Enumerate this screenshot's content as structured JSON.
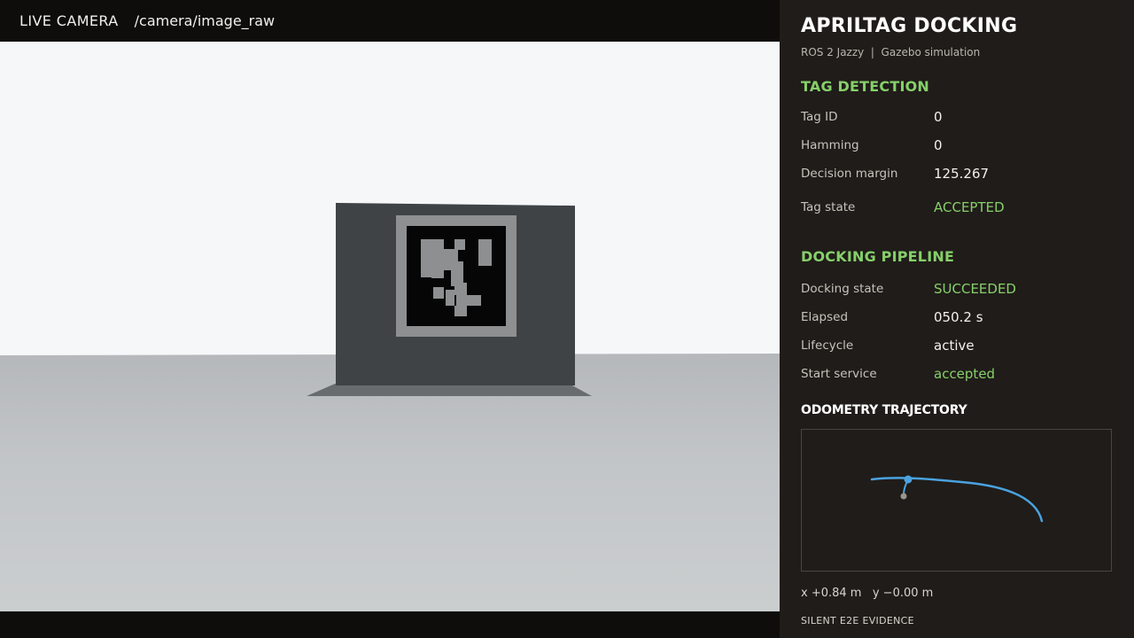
{
  "camera": {
    "title": "LIVE CAMERA",
    "topic": "/camera/image_raw"
  },
  "panel": {
    "title": "APRILTAG DOCKING",
    "subtitle": "ROS 2 Jazzy  |  Gazebo simulation",
    "tag_detection": {
      "heading": "TAG DETECTION",
      "rows": [
        {
          "label": "Tag ID",
          "value": "0"
        },
        {
          "label": "Hamming",
          "value": "0"
        },
        {
          "label": "Decision margin",
          "value": "125.267"
        },
        {
          "label": "Tag state",
          "value": "ACCEPTED"
        }
      ]
    },
    "docking_pipeline": {
      "heading": "DOCKING PIPELINE",
      "rows": [
        {
          "label": "Docking state",
          "value": "SUCCEEDED"
        },
        {
          "label": "Elapsed",
          "value": "050.2 s"
        },
        {
          "label": "Lifecycle",
          "value": "active"
        },
        {
          "label": "Start service",
          "value": "accepted"
        }
      ]
    },
    "odometry": {
      "heading": "ODOMETRY TRAJECTORY",
      "readout": "x +0.84 m   y −0.00 m"
    },
    "footer": "SILENT E2E EVIDENCE"
  },
  "colors": {
    "accent_green": "#86d06a",
    "trajectory_blue": "#4aa3e0",
    "panel_bg": "#201c19"
  }
}
